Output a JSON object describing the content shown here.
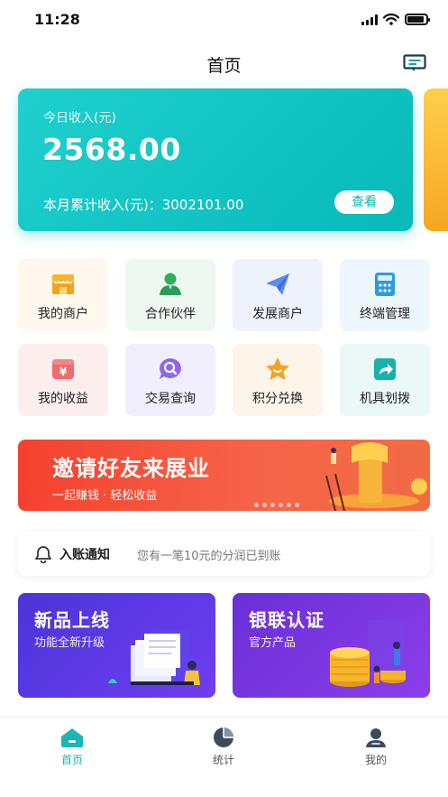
{
  "status_bar": {
    "time": "11:28"
  },
  "nav": {
    "title": "首页"
  },
  "income_card": {
    "today_label": "今日收入(元)",
    "today_amount": "2568.00",
    "month_label": "本月累计收入(元)：3002101.00",
    "view_button": "查看"
  },
  "menu": {
    "items": [
      {
        "label": "我的商户",
        "icon": "shop-icon"
      },
      {
        "label": "合作伙伴",
        "icon": "partner-icon"
      },
      {
        "label": "发展商户",
        "icon": "paper-plane-icon"
      },
      {
        "label": "终端管理",
        "icon": "pos-terminal-icon"
      },
      {
        "label": "我的收益",
        "icon": "yen-wallet-icon"
      },
      {
        "label": "交易查询",
        "icon": "search-chat-icon"
      },
      {
        "label": "积分兑换",
        "icon": "star-icon"
      },
      {
        "label": "机具划拨",
        "icon": "share-arrow-icon"
      }
    ]
  },
  "banner": {
    "title": "邀请好友来展业",
    "subtitle": "一起赚钱 · 轻松收益"
  },
  "notice": {
    "label": "入账通知",
    "text": "您有一笔10元的分润已到账"
  },
  "promos": [
    {
      "title": "新品上线",
      "subtitle": "功能全新升级"
    },
    {
      "title": "银联认证",
      "subtitle": "官方产品"
    }
  ],
  "tabbar": {
    "items": [
      {
        "label": "首页",
        "icon": "home-icon",
        "active": true
      },
      {
        "label": "统计",
        "icon": "pie-chart-icon",
        "active": false
      },
      {
        "label": "我的",
        "icon": "user-icon",
        "active": false
      }
    ]
  },
  "colors": {
    "accent": "#14b8b8",
    "banner_red": "#f4412e",
    "promo_purple": "#5b3be0"
  }
}
